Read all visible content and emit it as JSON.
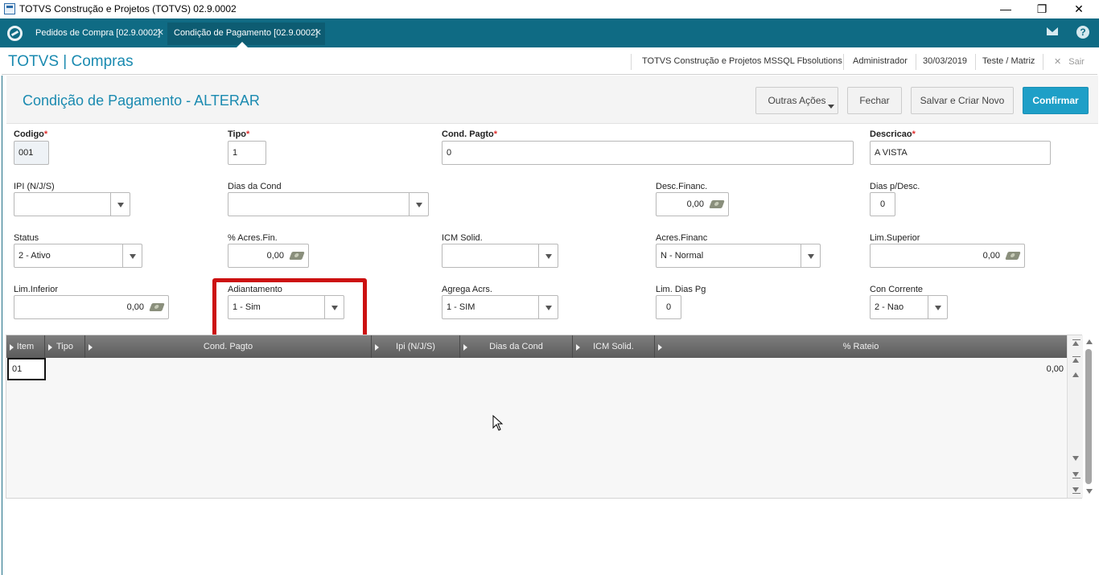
{
  "window": {
    "title": "TOTVS Construção e Projetos (TOTVS) 02.9.0002"
  },
  "tabs": [
    {
      "label": "Pedidos de Compra [02.9.0002]"
    },
    {
      "label": "Condição de Pagamento [02.9.0002]"
    }
  ],
  "header": {
    "brand": "TOTVS | Compras",
    "environment": "TOTVS Construção e Projetos MSSQL Fbsolutions",
    "user": "Administrador",
    "date": "30/03/2019",
    "branch": "Teste / Matriz",
    "exit_label": "Sair"
  },
  "form": {
    "title": "Condição de Pagamento - ALTERAR",
    "buttons": {
      "outras_acoes": "Outras Ações",
      "fechar": "Fechar",
      "salvar_criar": "Salvar e Criar Novo",
      "confirmar": "Confirmar"
    },
    "fields": {
      "codigo": {
        "label": "Codigo",
        "value": "001"
      },
      "tipo": {
        "label": "Tipo",
        "value": "1"
      },
      "cond_pagto": {
        "label": "Cond. Pagto",
        "value": "0"
      },
      "descricao": {
        "label": "Descricao",
        "value": "A VISTA"
      },
      "ipi": {
        "label": "IPI (N/J/S)",
        "value": ""
      },
      "dias_cond": {
        "label": "Dias da Cond",
        "value": ""
      },
      "desc_financ": {
        "label": "Desc.Financ.",
        "value": "0,00"
      },
      "dias_p_desc": {
        "label": "Dias p/Desc.",
        "value": "0"
      },
      "status": {
        "label": "Status",
        "value": "2 - Ativo"
      },
      "acres_fin": {
        "label": "% Acres.Fin.",
        "value": "0,00"
      },
      "icm_solid": {
        "label": "ICM Solid.",
        "value": ""
      },
      "acres_financ": {
        "label": "Acres.Financ",
        "value": "N - Normal"
      },
      "lim_superior": {
        "label": "Lim.Superior",
        "value": "0,00"
      },
      "lim_inferior": {
        "label": "Lim.Inferior",
        "value": "0,00"
      },
      "adiantamento": {
        "label": "Adiantamento",
        "value": "1 - Sim"
      },
      "agrega_acrs": {
        "label": "Agrega Acrs.",
        "value": "1 - SIM"
      },
      "lim_dias_pg": {
        "label": "Lim. Dias Pg",
        "value": "0"
      },
      "con_corrente": {
        "label": "Con Corrente",
        "value": "2 - Nao"
      }
    }
  },
  "grid": {
    "columns": [
      "Item",
      "Tipo",
      "Cond. Pagto",
      "Ipi (N/J/S)",
      "Dias da Cond",
      "ICM Solid.",
      "% Rateio"
    ],
    "rows": [
      {
        "item": "01",
        "rateio": "0,00"
      }
    ]
  },
  "colors": {
    "tabbar": "#0f6b84",
    "accent": "#1a8ab0",
    "primary_button": "#1e9fc7",
    "highlight": "#cc1111",
    "required_star": "#e03030"
  }
}
